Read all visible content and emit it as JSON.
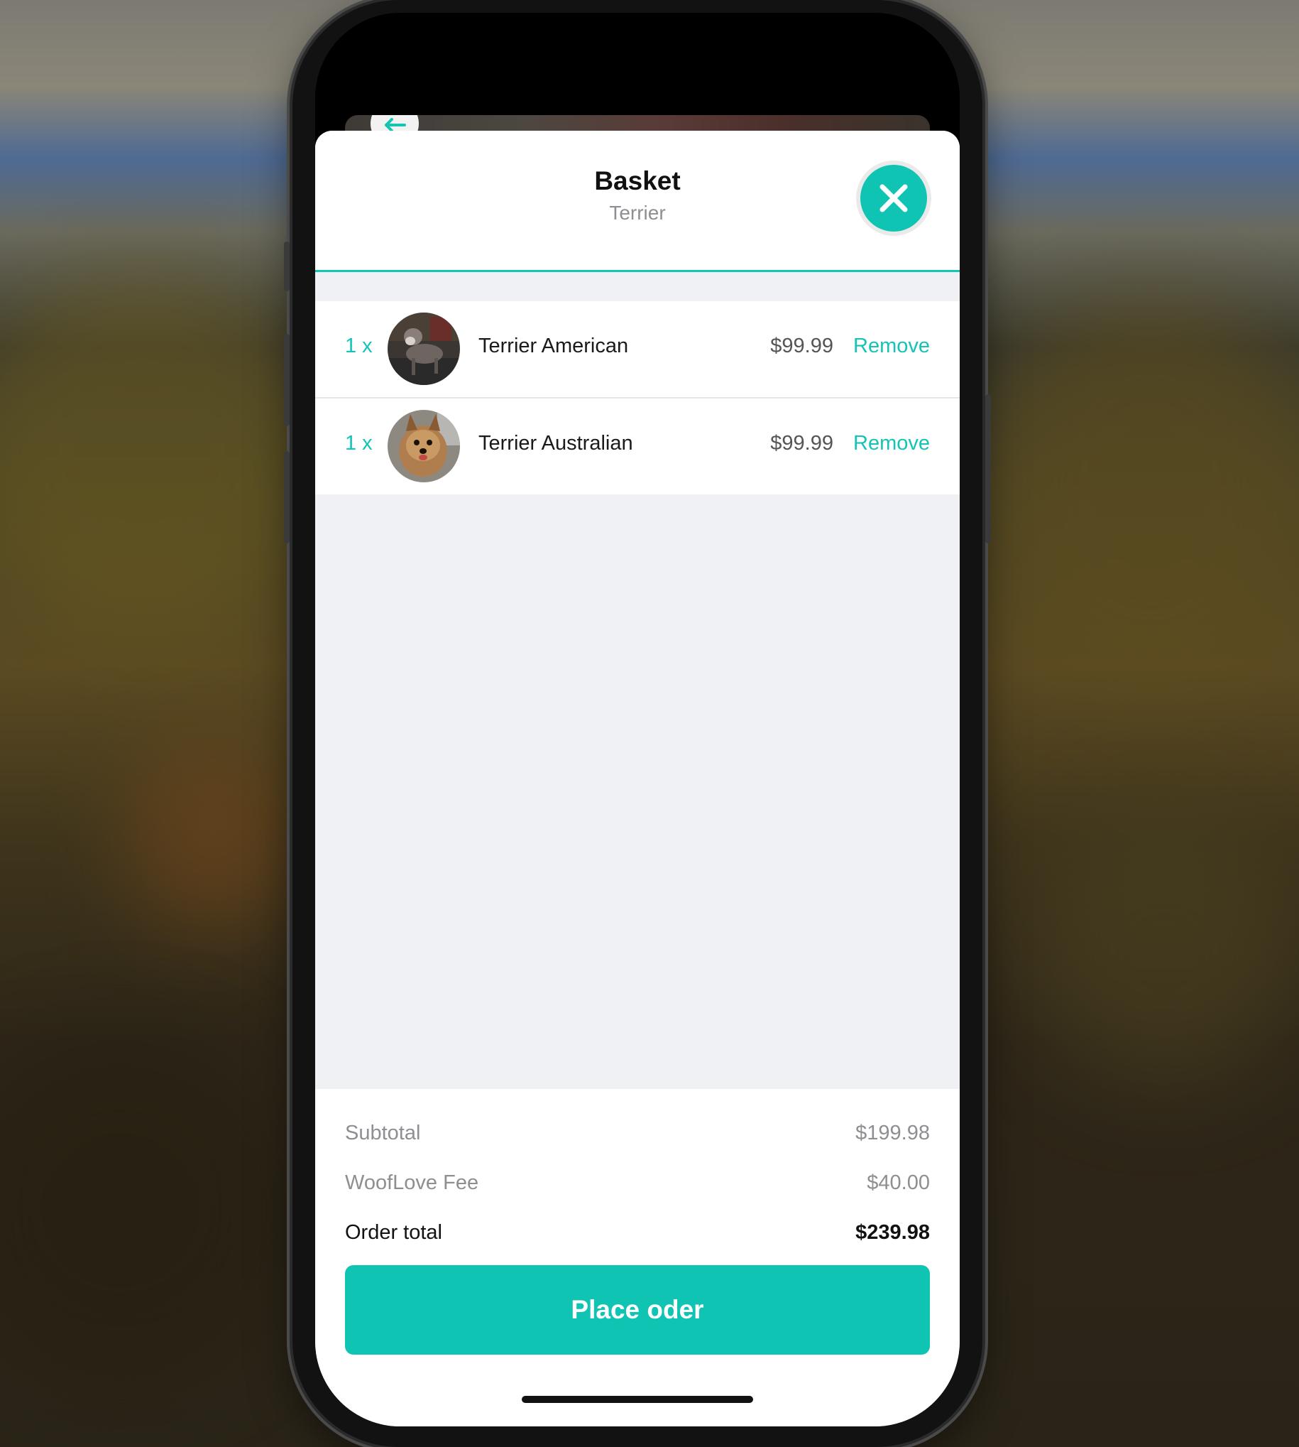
{
  "basket": {
    "title": "Basket",
    "subtitle": "Terrier",
    "close_icon": "close-x-icon",
    "back_icon": "arrow-left-icon"
  },
  "items": [
    {
      "quantity": "1 x",
      "name": "Terrier American",
      "price": "$99.99",
      "remove_label": "Remove"
    },
    {
      "quantity": "1 x",
      "name": "Terrier Australian",
      "price": "$99.99",
      "remove_label": "Remove"
    }
  ],
  "summary": {
    "subtotal_label": "Subtotal",
    "subtotal_value": "$199.98",
    "fee_label": "WoofLove Fee",
    "fee_value": "$40.00",
    "total_label": "Order total",
    "total_value": "$239.98"
  },
  "place_order_label": "Place oder",
  "colors": {
    "accent": "#0fc4b3",
    "background": "#f0f1f4",
    "muted_text": "#8e8e93"
  }
}
